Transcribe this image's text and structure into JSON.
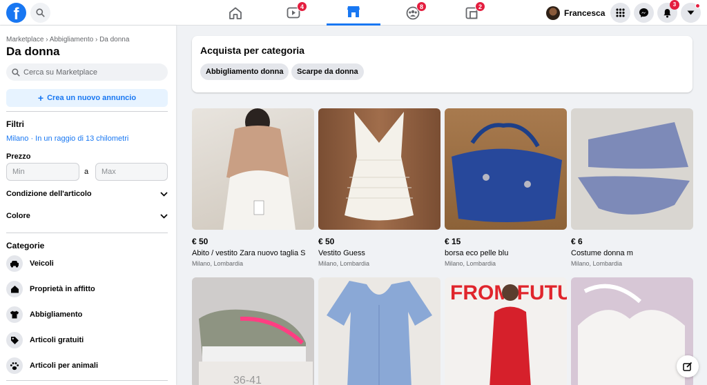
{
  "header": {
    "logo_letter": "f",
    "profile_name": "Francesca",
    "nav": [
      {
        "name": "home",
        "badge": ""
      },
      {
        "name": "watch",
        "badge": "4"
      },
      {
        "name": "marketplace",
        "badge": ""
      },
      {
        "name": "groups",
        "badge": "8"
      },
      {
        "name": "gaming",
        "badge": "2"
      }
    ],
    "notifications_badge": "3",
    "brand_color": "#1877f2"
  },
  "sidebar": {
    "breadcrumb": "Marketplace › Abbigliamento › Da donna",
    "title": "Da donna",
    "search_placeholder": "Cerca su Marketplace",
    "create_label": "Crea un nuovo annuncio",
    "filters_heading": "Filtri",
    "location": "Milano · In un raggio di 13 chilometri",
    "price_label": "Prezzo",
    "price_min_placeholder": "Min",
    "price_separator": "a",
    "price_max_placeholder": "Max",
    "condition_label": "Condizione dell'articolo",
    "color_label": "Colore",
    "categories_heading": "Categorie",
    "categories": [
      {
        "label": "Veicoli",
        "icon": "car-icon"
      },
      {
        "label": "Proprietà in affitto",
        "icon": "house-icon"
      },
      {
        "label": "Abbigliamento",
        "icon": "shirt-icon"
      },
      {
        "label": "Articoli gratuiti",
        "icon": "tag-icon"
      },
      {
        "label": "Articoli per animali",
        "icon": "paw-icon"
      }
    ]
  },
  "main": {
    "category_card_title": "Acquista per categoria",
    "chips": [
      "Abbigliamento donna",
      "Scarpe da donna"
    ],
    "listings": [
      {
        "price": "€ 50",
        "title": "Abito / vestito Zara nuovo taglia S",
        "location": "Milano, Lombardia"
      },
      {
        "price": "€ 50",
        "title": "Vestito Guess",
        "location": "Milano, Lombardia"
      },
      {
        "price": "€ 15",
        "title": "borsa eco pelle blu",
        "location": "Milano, Lombardia"
      },
      {
        "price": "€ 6",
        "title": "Costume donna m",
        "location": "Milano, Lombardia"
      },
      {
        "price": "",
        "title": "",
        "location": "",
        "photo_text": "36-41"
      },
      {
        "price": "",
        "title": "",
        "location": ""
      },
      {
        "price": "",
        "title": "",
        "location": "",
        "photo_text": "FROM FUTURE"
      },
      {
        "price": "",
        "title": "",
        "location": ""
      }
    ]
  }
}
